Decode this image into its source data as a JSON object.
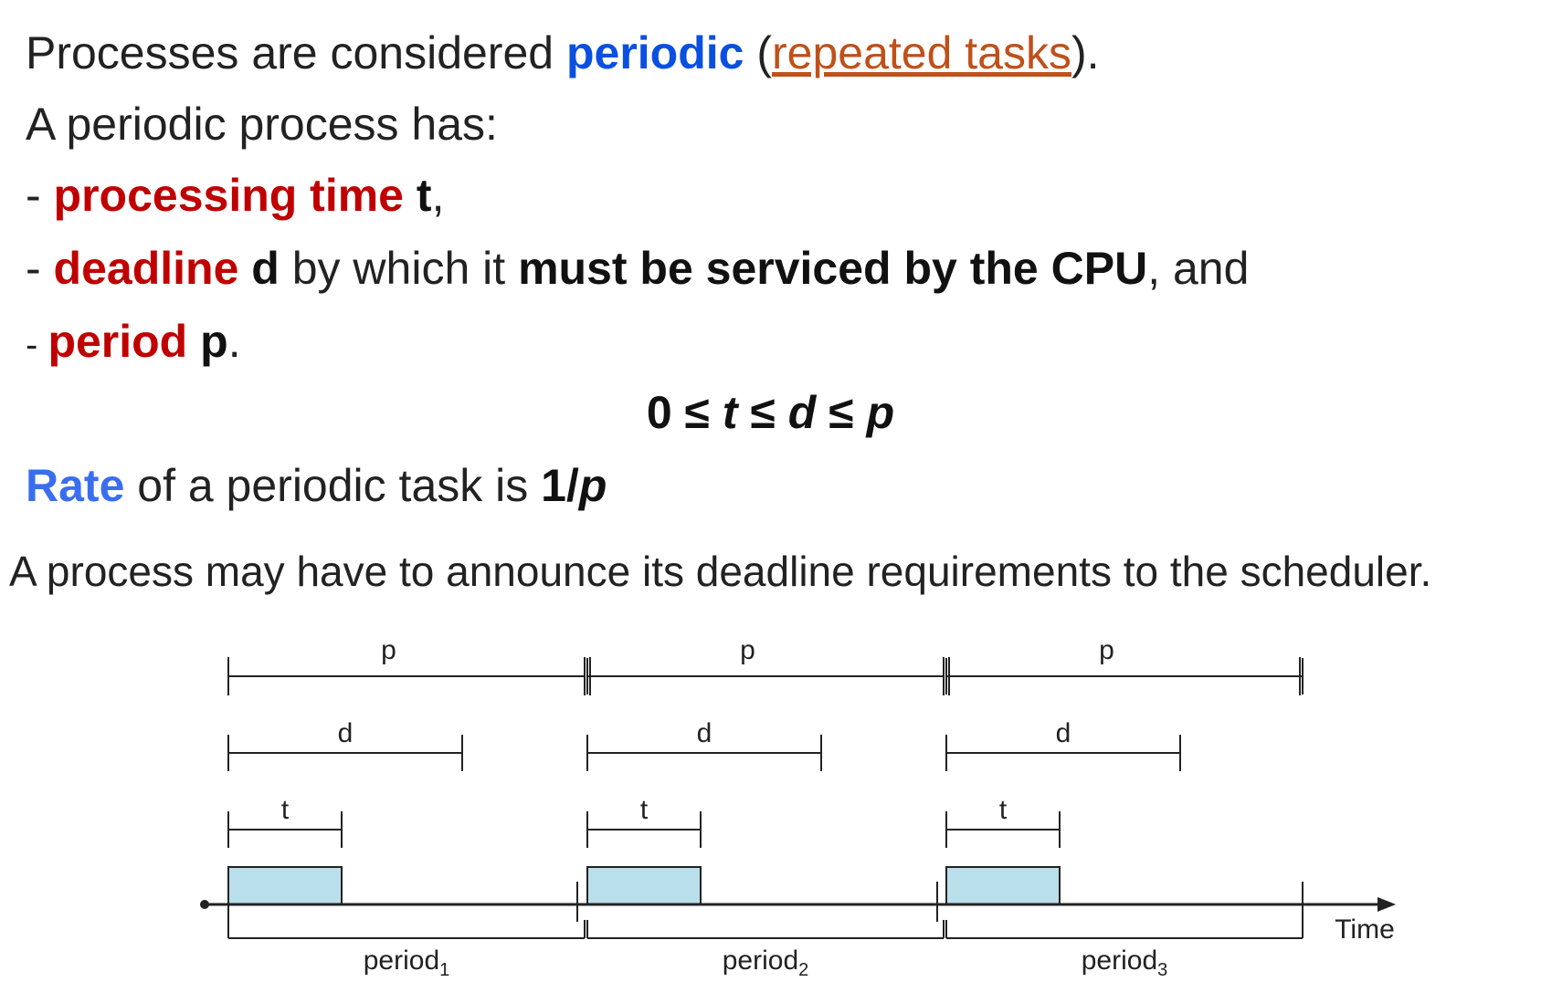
{
  "text": {
    "line1": {
      "a": "Processes are considered ",
      "b": "periodic",
      "c": " (",
      "d": "repeated tasks",
      "e": ")."
    },
    "line2": "A periodic process has:",
    "line3": {
      "a": "- ",
      "b": "processing time",
      "c": " ",
      "d": "t",
      "e": ","
    },
    "line4": {
      "a": "- ",
      "b": "deadline",
      "c": " ",
      "d": "d",
      "e": " by which it ",
      "f": "must be serviced by the CPU",
      "g": ", and"
    },
    "line5": {
      "a": "- ",
      "b": "period",
      "c": " ",
      "d": "p",
      "e": "."
    },
    "line6": {
      "a": "0 ≤ ",
      "b": "t",
      "c": " ≤ ",
      "d": "d",
      "e": " ≤ ",
      "f": "p"
    },
    "line7": {
      "a": "Rate",
      "b": " of a periodic task is ",
      "c": "1/",
      "d": "p"
    },
    "line8": "A process may have to announce its deadline requirements to the scheduler."
  },
  "diagram": {
    "p_label": "p",
    "d_label": "d",
    "t_label": "t",
    "period_word": "period",
    "period_subscripts": [
      "1",
      "2",
      "3"
    ],
    "axis_label": "Time",
    "colors": {
      "box_fill": "#b9dfea",
      "line": "#222222"
    }
  }
}
